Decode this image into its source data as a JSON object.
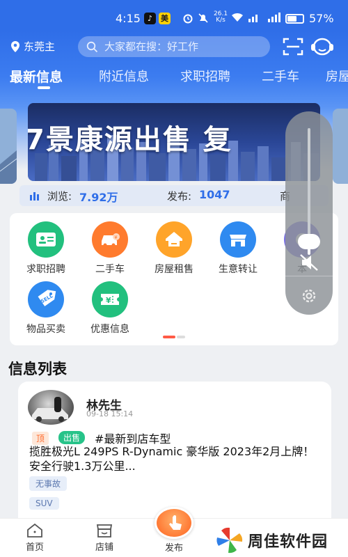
{
  "status_bar": {
    "time": "4:15",
    "app_badge": "美",
    "net_speed_top": "26.1",
    "net_speed_unit": "K/s",
    "battery": "57%"
  },
  "header": {
    "city": "东莞主",
    "search_placeholder": "大家都在搜：好工作",
    "tabs": [
      "最新信息",
      "附近信息",
      "求职招聘",
      "二手车",
      "房屋"
    ]
  },
  "banner": {
    "text": "7景康源出售  复"
  },
  "stats": {
    "views_label": "浏览:",
    "views_value": "7.92万",
    "posts_label": "发布:",
    "posts_value": "1047",
    "merchants_label": "商"
  },
  "categories": [
    {
      "label": "求职招聘",
      "color": "#22c07e",
      "icon": "id-card-icon"
    },
    {
      "label": "二手车",
      "color": "#ff7b2e",
      "icon": "car-icon"
    },
    {
      "label": "房屋租售",
      "color": "#ffa42a",
      "icon": "house-icon"
    },
    {
      "label": "生意转让",
      "color": "#2f8af0",
      "icon": "shop-icon"
    },
    {
      "label": "本",
      "color": "#7a70e6",
      "icon": "service-icon"
    },
    {
      "label": "物品买卖",
      "color": "#2f8af0",
      "icon": "price-tag-icon"
    },
    {
      "label": "优惠信息",
      "color": "#22c07e",
      "icon": "coupon-icon"
    }
  ],
  "list": {
    "section_title": "信息列表",
    "post": {
      "author": "林先生",
      "time": "09-18 15:14",
      "tag_top": "顶",
      "tag_type": "出售",
      "hashtag": "#最新到店车型",
      "title": "揽胜极光L 249PS R-Dynamic 豪华版 2023年2月上牌！ 安全行驶1.3万公里...",
      "chips": [
        "无事故",
        "SUV"
      ]
    }
  },
  "bottom_nav": {
    "home": "首页",
    "shop": "店铺",
    "publish": "发布"
  },
  "watermark": "周佳软件园",
  "colors": {
    "primary": "#2f6ee8",
    "accent": "#ff6a2b"
  }
}
